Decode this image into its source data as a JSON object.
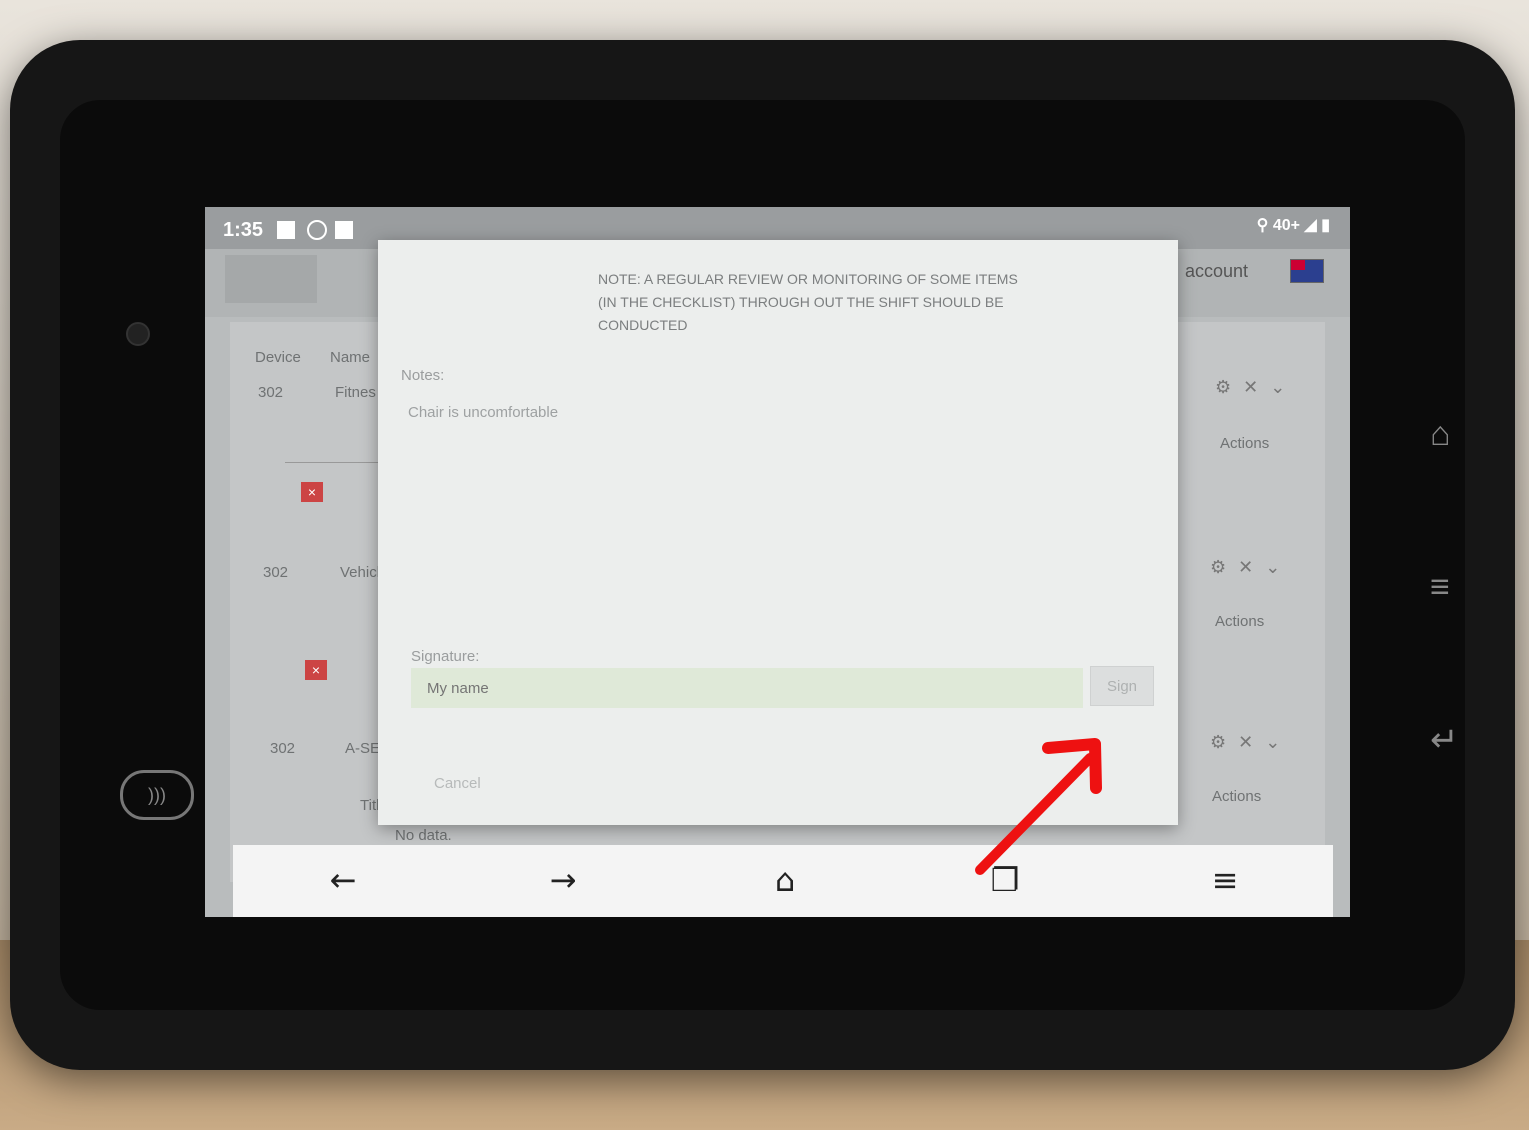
{
  "status_bar": {
    "time": "1:35",
    "network": "40+"
  },
  "app_header": {
    "account_label": "account"
  },
  "background_table": {
    "headers": [
      "Device",
      "Name"
    ],
    "rows": [
      {
        "device": "302",
        "name": "Fitnes"
      },
      {
        "device": "302",
        "name": "Vehicl"
      },
      {
        "device": "302",
        "name": "A-SER"
      }
    ],
    "actions_label": "Actions",
    "title_label": "Title",
    "no_data": "No data.",
    "delete_glyph": "×"
  },
  "modal": {
    "note_text": "NOTE:  A REGULAR REVIEW OR MONITORING OF SOME ITEMS  (IN THE CHECKLIST) THROUGH OUT THE SHIFT SHOULD BE CONDUCTED",
    "notes_label": "Notes:",
    "notes_value": "Chair is uncomfortable",
    "signature_label": "Signature:",
    "signature_placeholder": "My name",
    "sign_button": "Sign",
    "cancel_button": "Cancel"
  },
  "nav_bar": {
    "back": "←",
    "forward": "→",
    "home": "⌂",
    "tabs": "❐",
    "menu": "≡"
  },
  "colors": {
    "annotation_arrow": "#ee1111",
    "signature_field": "#dfe9d8"
  }
}
